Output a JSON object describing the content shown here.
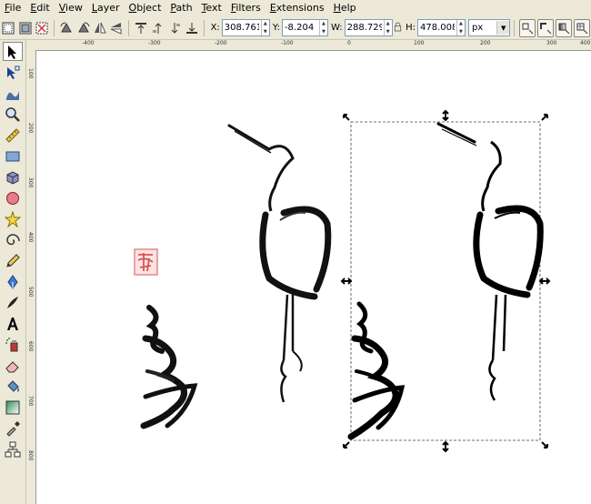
{
  "menubar": {
    "items": [
      "File",
      "Edit",
      "View",
      "Layer",
      "Object",
      "Path",
      "Text",
      "Filters",
      "Extensions",
      "Help"
    ]
  },
  "toolbar": {
    "x_label": "X:",
    "x_value": "308.761",
    "y_label": "Y:",
    "y_value": "-8.204",
    "w_label": "W:",
    "w_value": "288.729",
    "h_label": "H:",
    "h_value": "478.008",
    "unit": "px",
    "icons": [
      "select-all-icon",
      "select-all-layers-icon",
      "deselect-icon",
      "rotate-ccw-icon",
      "rotate-cw-icon",
      "flip-horizontal-icon",
      "flip-vertical-icon",
      "raise-to-top-icon",
      "raise-icon",
      "lower-icon",
      "lower-to-bottom-icon",
      "scale-stroke-icon",
      "scale-corners-icon",
      "move-gradients-icon",
      "move-patterns-icon"
    ]
  },
  "ruler": {
    "top_labels": [
      "-400",
      "-300",
      "-200",
      "-100",
      "0",
      "100",
      "200",
      "300",
      "400"
    ],
    "left_labels": [
      "100",
      "200",
      "300",
      "400",
      "500",
      "600",
      "700",
      "800"
    ]
  },
  "tools": [
    "selector-arrow-icon",
    "node-edit-icon",
    "tweak-icon",
    "zoom-icon",
    "measure-icon",
    "rectangle-icon",
    "3d-box-icon",
    "ellipse-icon",
    "star-icon",
    "spiral-icon",
    "pencil-icon",
    "pen-icon",
    "calligraphy-icon",
    "text-icon",
    "spray-icon",
    "eraser-icon",
    "paint-bucket-icon",
    "gradient-icon",
    "dropper-icon",
    "connector-icon"
  ],
  "colors": {
    "chrome": "#ece9d8",
    "canvas": "#ffffff",
    "stamp_red": "#d9534f",
    "ink": "#000000"
  }
}
